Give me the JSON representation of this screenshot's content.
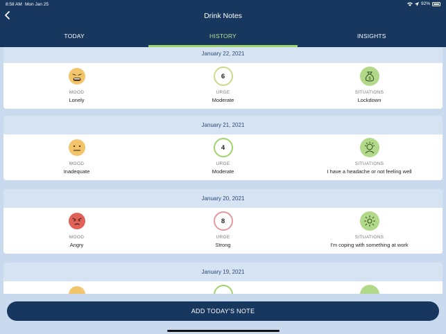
{
  "status": {
    "time": "8:58 AM",
    "date": "Mon Jan 25",
    "battery": "92%"
  },
  "header": {
    "title": "Drink Notes"
  },
  "tabs": [
    {
      "label": "TODAY"
    },
    {
      "label": "HISTORY",
      "active": true
    },
    {
      "label": "INSIGHTS"
    }
  ],
  "labels": {
    "mood": "MOOD",
    "urge": "URGE",
    "situations": "SITUATIONS"
  },
  "entries": [
    {
      "date": "January 22, 2021",
      "mood": "Lonely",
      "urge_number": "6",
      "urge": "Moderate",
      "situation": "Lockdown",
      "mood_icon": "sad-face-icon",
      "situation_icon": "money-bag-icon"
    },
    {
      "date": "January 21, 2021",
      "mood": "Inadequate",
      "urge_number": "4",
      "urge": "Moderate",
      "situation": "I have a headache or not feeling well",
      "mood_icon": "neutral-face-icon",
      "situation_icon": "headache-icon"
    },
    {
      "date": "January 20, 2021",
      "mood": "Angry",
      "urge_number": "8",
      "urge": "Strong",
      "situation": "I'm coping with something at work",
      "mood_icon": "angry-face-icon",
      "situation_icon": "work-stress-icon"
    },
    {
      "date": "January 19, 2021"
    }
  ],
  "add_button": {
    "label": "ADD TODAY'S NOTE"
  },
  "colors": {
    "navy": "#17375e",
    "accent": "#9fd46a",
    "background": "#c9d9ee"
  }
}
